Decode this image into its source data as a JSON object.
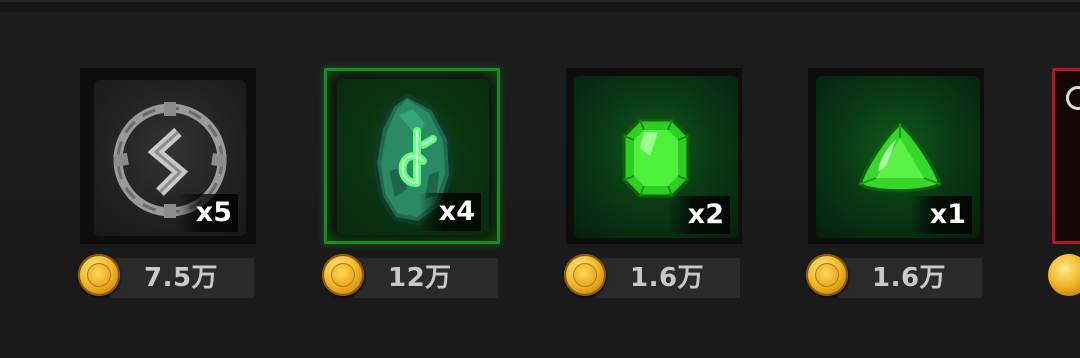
{
  "shop": {
    "items": [
      {
        "icon": "gray-rune-stone-icon",
        "quantity": "x5",
        "price": "7.5万"
      },
      {
        "icon": "green-rune-fragment-icon",
        "quantity": "x4",
        "price": "12万"
      },
      {
        "icon": "green-emerald-gem-icon",
        "quantity": "x2",
        "price": "1.6万"
      },
      {
        "icon": "green-trillion-gem-icon",
        "quantity": "x1",
        "price": "1.6万"
      }
    ],
    "currency_icon": "gold-coin-icon",
    "colors": {
      "selected_border": "#1c8a23",
      "partial_border": "#b11818",
      "price_text": "#c9c9c9",
      "quantity_text": "#ffffff"
    }
  }
}
